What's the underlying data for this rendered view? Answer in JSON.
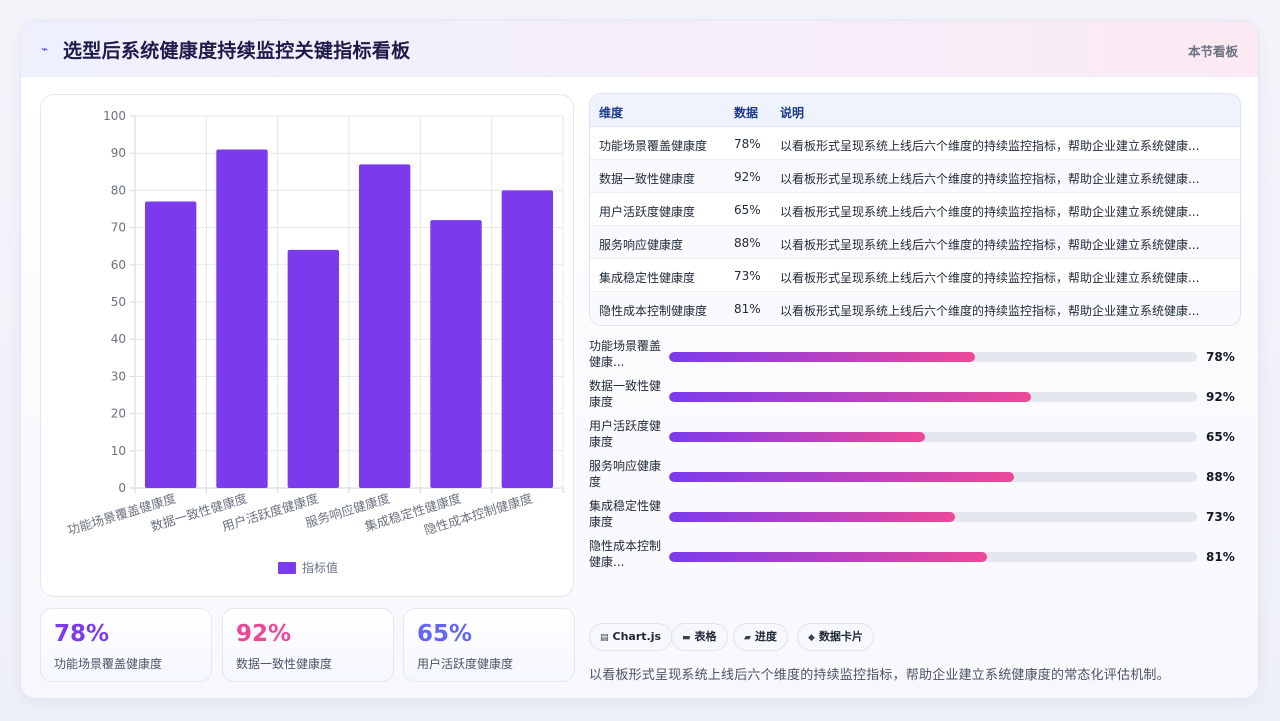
{
  "header": {
    "icon": "pulse-icon",
    "title": "选型后系统健康度持续监控关键指标看板",
    "section_link": "本节看板"
  },
  "chart_data": {
    "type": "bar",
    "categories": [
      "功能场景覆盖健康度",
      "数据一致性健康度",
      "用户活跃度健康度",
      "服务响应健康度",
      "集成稳定性健康度",
      "隐性成本控制健康度"
    ],
    "series": [
      {
        "name": "指标值",
        "values": [
          77,
          91,
          64,
          87,
          72,
          80
        ],
        "color": "#7c3aed"
      }
    ],
    "ylim": [
      0,
      100
    ],
    "yticks": [
      "0",
      "10",
      "20",
      "30",
      "40",
      "50",
      "60",
      "70",
      "80",
      "90",
      "100"
    ],
    "grid": true,
    "legend": "bottom"
  },
  "stat_cards": [
    {
      "value": "78%",
      "label": "功能场景覆盖健康度",
      "color": "#7c3aed"
    },
    {
      "value": "92%",
      "label": "数据一致性健康度",
      "color": "#ec4899"
    },
    {
      "value": "65%",
      "label": "用户活跃度健康度",
      "color": "#6366f1"
    }
  ],
  "table": {
    "headers": [
      "维度",
      "数据",
      "说明"
    ],
    "rows": [
      {
        "dim": "功能场景覆盖健康度",
        "value": "78%",
        "desc": "以看板形式呈现系统上线后六个维度的持续监控指标，帮助企业建立系统健康..."
      },
      {
        "dim": "数据一致性健康度",
        "value": "92%",
        "desc": "以看板形式呈现系统上线后六个维度的持续监控指标，帮助企业建立系统健康..."
      },
      {
        "dim": "用户活跃度健康度",
        "value": "65%",
        "desc": "以看板形式呈现系统上线后六个维度的持续监控指标，帮助企业建立系统健康..."
      },
      {
        "dim": "服务响应健康度",
        "value": "88%",
        "desc": "以看板形式呈现系统上线后六个维度的持续监控指标，帮助企业建立系统健康..."
      },
      {
        "dim": "集成稳定性健康度",
        "value": "73%",
        "desc": "以看板形式呈现系统上线后六个维度的持续监控指标，帮助企业建立系统健康..."
      },
      {
        "dim": "隐性成本控制健康度",
        "value": "81%",
        "desc": "以看板形式呈现系统上线后六个维度的持续监控指标，帮助企业建立系统健康..."
      }
    ]
  },
  "progress": [
    {
      "label": "功能场景覆盖健康...",
      "value": "78%",
      "fraction": 0.58
    },
    {
      "label": "数据一致性健康度",
      "value": "92%",
      "fraction": 0.685
    },
    {
      "label": "用户活跃度健康度",
      "value": "65%",
      "fraction": 0.485
    },
    {
      "label": "服务响应健康度",
      "value": "88%",
      "fraction": 0.653
    },
    {
      "label": "集成稳定性健康度",
      "value": "73%",
      "fraction": 0.542
    },
    {
      "label": "隐性成本控制健康...",
      "value": "81%",
      "fraction": 0.602
    }
  ],
  "tags": [
    {
      "icon": "chart-icon",
      "label": "Chart.js"
    },
    {
      "icon": "table-icon",
      "label": "表格"
    },
    {
      "icon": "progress-icon",
      "label": "进度"
    },
    {
      "icon": "card-icon",
      "label": "数据卡片"
    }
  ],
  "footer_text": "以看板形式呈现系统上线后六个维度的持续监控指标，帮助企业建立系统健康度的常态化评估机制。"
}
